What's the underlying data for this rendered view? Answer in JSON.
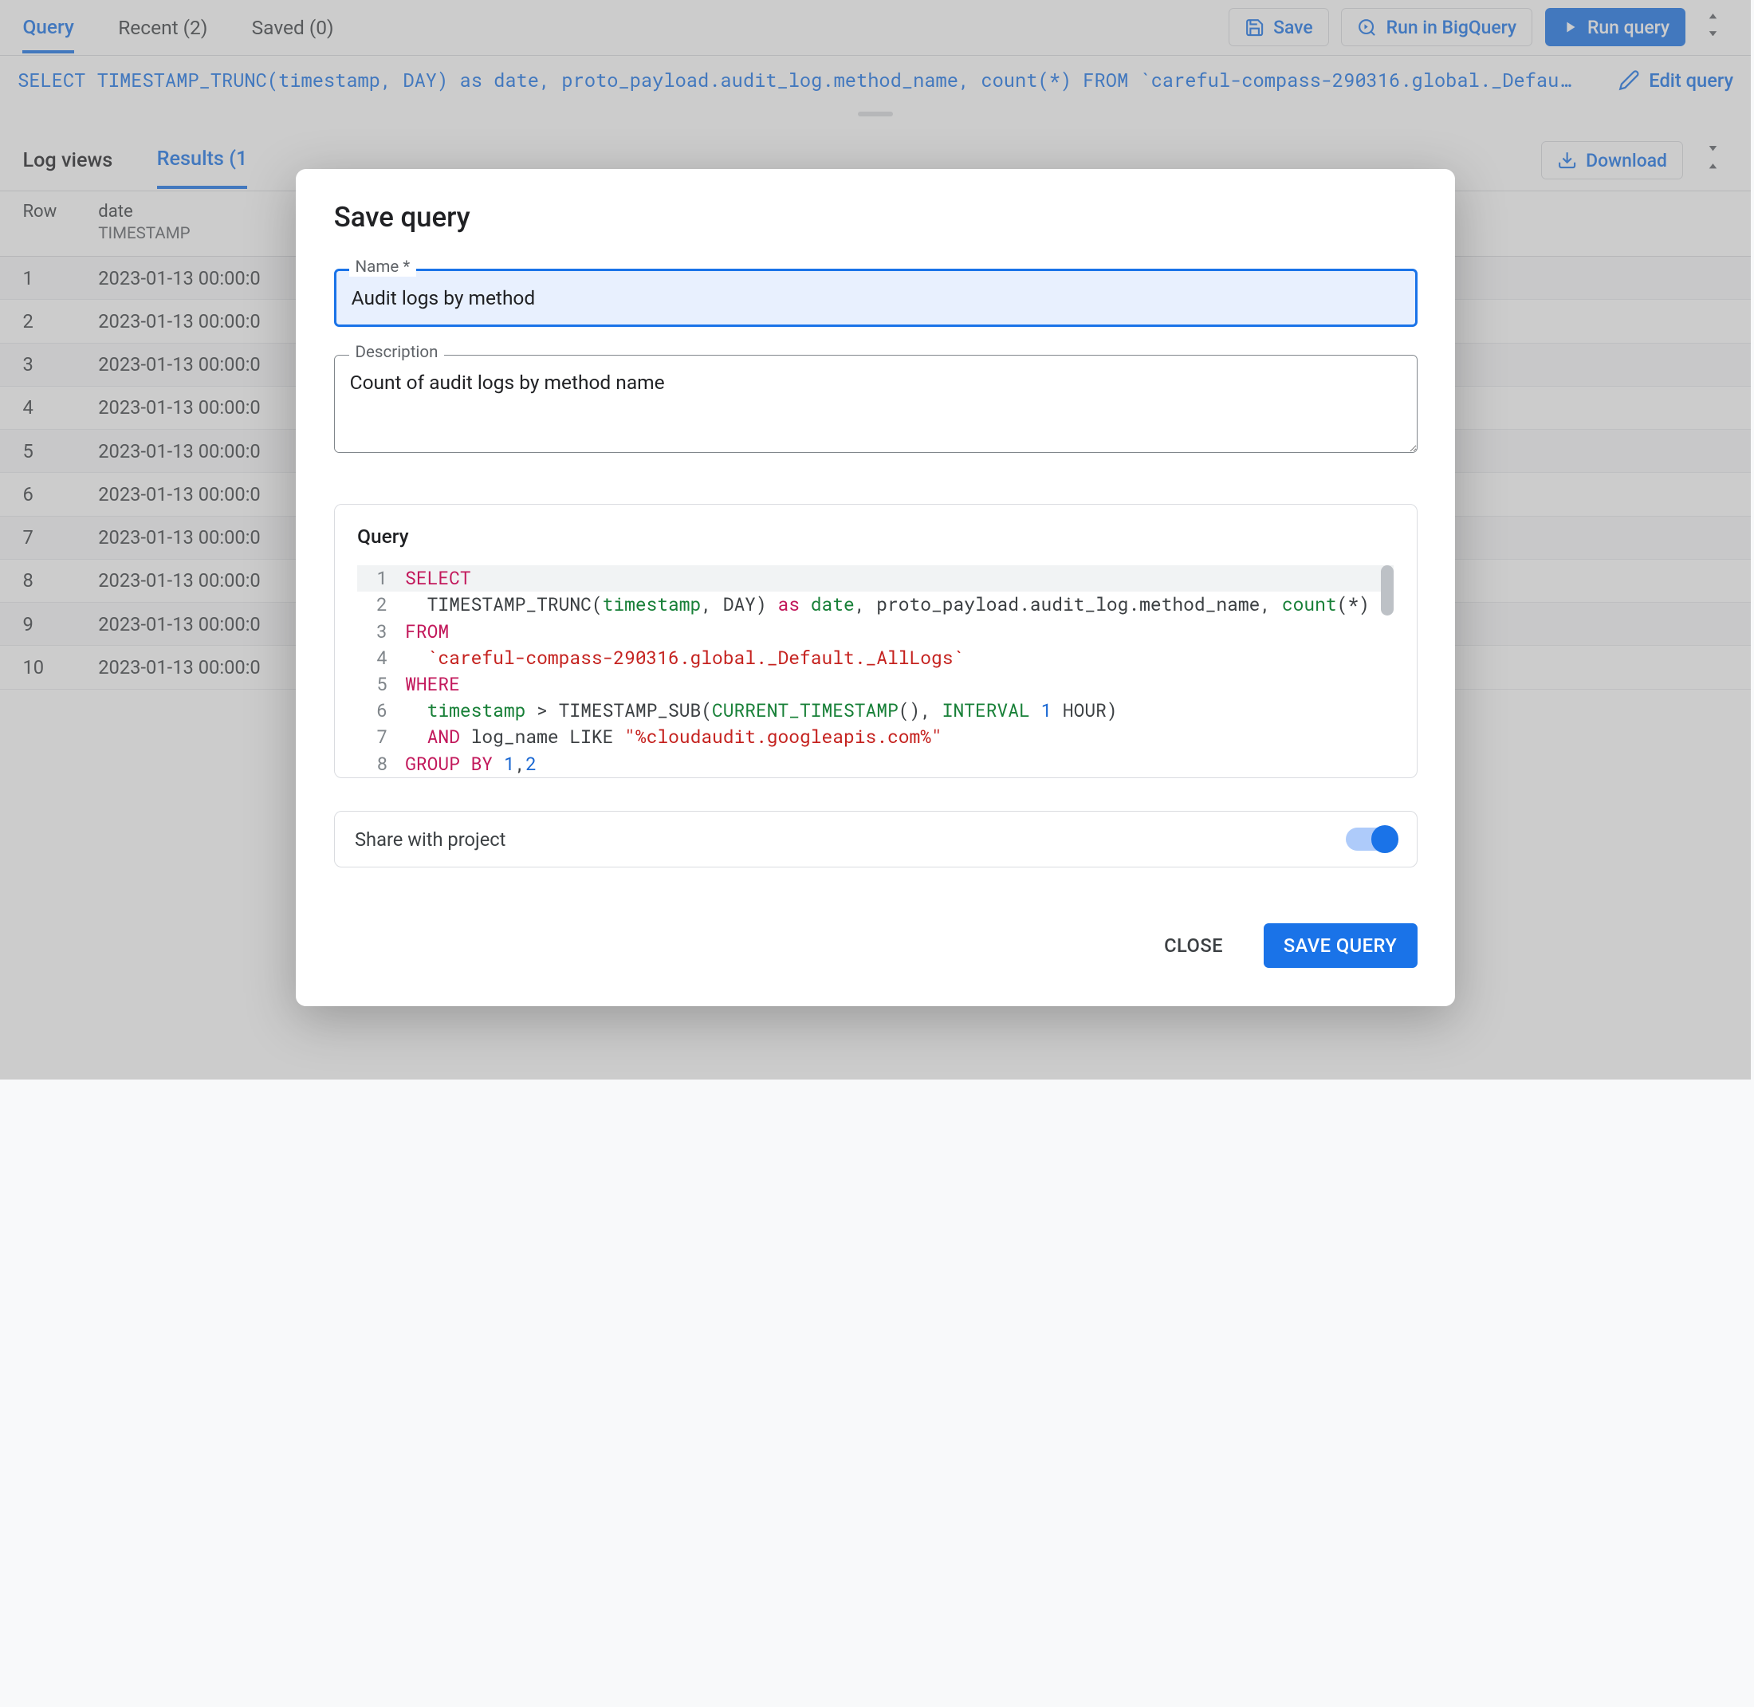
{
  "topTabs": {
    "query": "Query",
    "recent": "Recent (2)",
    "saved": "Saved (0)"
  },
  "topButtons": {
    "save": "Save",
    "runBigQuery": "Run in BigQuery",
    "runQuery": "Run query"
  },
  "queryBar": {
    "sql": "SELECT TIMESTAMP_TRUNC(timestamp, DAY) as date, proto_payload.audit_log.method_name, count(*) FROM `careful-compass-290316.global._Defau…",
    "editQuery": "Edit query"
  },
  "lowerTabs": {
    "logViews": "Log views",
    "results": "Results (1"
  },
  "lowerButtons": {
    "download": "Download"
  },
  "table": {
    "headers": {
      "row": "Row",
      "dateLabel": "date",
      "dateType": "TIMESTAMP"
    },
    "rows": [
      {
        "n": "1",
        "date": "2023-01-13 00:00:0"
      },
      {
        "n": "2",
        "date": "2023-01-13 00:00:0"
      },
      {
        "n": "3",
        "date": "2023-01-13 00:00:0"
      },
      {
        "n": "4",
        "date": "2023-01-13 00:00:0"
      },
      {
        "n": "5",
        "date": "2023-01-13 00:00:0"
      },
      {
        "n": "6",
        "date": "2023-01-13 00:00:0"
      },
      {
        "n": "7",
        "date": "2023-01-13 00:00:0"
      },
      {
        "n": "8",
        "date": "2023-01-13 00:00:0"
      },
      {
        "n": "9",
        "date": "2023-01-13 00:00:0"
      },
      {
        "n": "10",
        "date": "2023-01-13 00:00:0"
      }
    ]
  },
  "modal": {
    "title": "Save query",
    "nameLabel": "Name *",
    "nameValue": "Audit logs by method",
    "descLabel": "Description",
    "descValue": "Count of audit logs by method name",
    "queryLabel": "Query",
    "shareLabel": "Share with project",
    "shareOn": true,
    "close": "CLOSE",
    "save": "SAVE QUERY"
  },
  "queryLines": [
    {
      "n": "1",
      "tokens": [
        [
          "kw",
          "SELECT"
        ]
      ]
    },
    {
      "n": "2",
      "tokens": [
        [
          "txt",
          "  TIMESTAMP_TRUNC("
        ],
        [
          "id",
          "timestamp"
        ],
        [
          "txt",
          ", DAY) "
        ],
        [
          "kw",
          "as"
        ],
        [
          "txt",
          " "
        ],
        [
          "id",
          "date"
        ],
        [
          "txt",
          ", proto_payload.audit_log.method_name, "
        ],
        [
          "id",
          "count"
        ],
        [
          "txt",
          "(*)"
        ]
      ]
    },
    {
      "n": "3",
      "tokens": [
        [
          "kw",
          "FROM"
        ]
      ]
    },
    {
      "n": "4",
      "tokens": [
        [
          "txt",
          "  "
        ],
        [
          "str",
          "`careful-compass-290316.global._Default._AllLogs`"
        ]
      ]
    },
    {
      "n": "5",
      "tokens": [
        [
          "kw",
          "WHERE"
        ]
      ]
    },
    {
      "n": "6",
      "tokens": [
        [
          "txt",
          "  "
        ],
        [
          "id",
          "timestamp"
        ],
        [
          "txt",
          " > TIMESTAMP_SUB("
        ],
        [
          "id",
          "CURRENT_TIMESTAMP"
        ],
        [
          "txt",
          "(), "
        ],
        [
          "id",
          "INTERVAL"
        ],
        [
          "txt",
          " "
        ],
        [
          "num",
          "1"
        ],
        [
          "txt",
          " HOUR)"
        ]
      ]
    },
    {
      "n": "7",
      "tokens": [
        [
          "txt",
          "  "
        ],
        [
          "kw",
          "AND"
        ],
        [
          "txt",
          " log_name LIKE "
        ],
        [
          "str",
          "\"%cloudaudit.googleapis.com%\""
        ]
      ]
    },
    {
      "n": "8",
      "tokens": [
        [
          "kw",
          "GROUP BY"
        ],
        [
          "txt",
          " "
        ],
        [
          "num",
          "1"
        ],
        [
          "txt",
          ","
        ],
        [
          "num",
          "2"
        ]
      ]
    }
  ]
}
